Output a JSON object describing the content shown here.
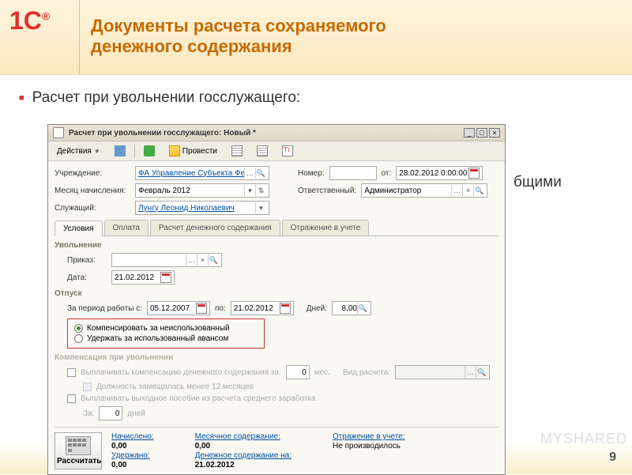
{
  "slide": {
    "title_l1": "Документы расчета сохраняемого",
    "title_l2": "денежного содержания",
    "bullet": "Расчет при увольнении госслужащего:",
    "bg_text": "бщими",
    "page_num": "9",
    "watermark": "MYSHARED"
  },
  "win": {
    "title": "Расчет при увольнении госслужащего: Новый *",
    "actions_label": "Действия",
    "provesti_label": "Провести"
  },
  "hdr": {
    "org_lbl": "Учреждение:",
    "org_val": "ФА Управление Субъекта Федерац",
    "month_lbl": "Месяц начисления:",
    "month_val": "Февраль 2012",
    "emp_lbl": "Служащий:",
    "emp_val": "Лунгу Леонид Николаевич",
    "num_lbl": "Номер:",
    "num_val": "",
    "from_lbl": "от:",
    "date_val": "28.02.2012 0:00:00",
    "resp_lbl": "Ответственный:",
    "resp_val": "Администратор"
  },
  "tabs": {
    "t1": "Условия",
    "t2": "Оплата",
    "t3": "Расчет денежного содержания",
    "t4": "Отражение в учете"
  },
  "dismiss": {
    "section": "Увольнение",
    "order_lbl": "Приказ:",
    "order_val": "",
    "date_lbl": "Дата:",
    "date_val": "21.02.2012"
  },
  "vac": {
    "section": "Отпуск",
    "period_lbl": "За период работы с:",
    "from_val": "05.12.2007",
    "to_lbl": "по:",
    "to_val": "21.02.2012",
    "days_lbl": "Дней:",
    "days_val": "8,00",
    "r1": "Компенсировать за неиспользованный",
    "r2": "Удержать за использованный авансом"
  },
  "comp": {
    "section": "Компенсация при увольнении",
    "c1_pre": "Выплачивать компенсацию денежного содержания за:",
    "c1_val": "0",
    "c1_post": "мес.",
    "kind_lbl": "Вид расчета:",
    "c2": "Должность замещалась менее 12 месяцев",
    "c3": "Выплачивать выходное пособие из расчета среднего заработка",
    "za_lbl": "За:",
    "za_val": "0",
    "za_post": "дней"
  },
  "foot": {
    "calc": "Рассчитать",
    "nach_lbl": "Начислено:",
    "nach_v": "0,00",
    "uder_lbl": "Удержано:",
    "uder_v": "0,00",
    "ms_lbl": "Месячное содержание:",
    "ms_v": "0,00",
    "dc_lbl": "Денежное содержание на:",
    "dc_v": "21.02.2012",
    "otr_lbl": "Отражение в учете:",
    "otr_v": "Не производилось"
  }
}
